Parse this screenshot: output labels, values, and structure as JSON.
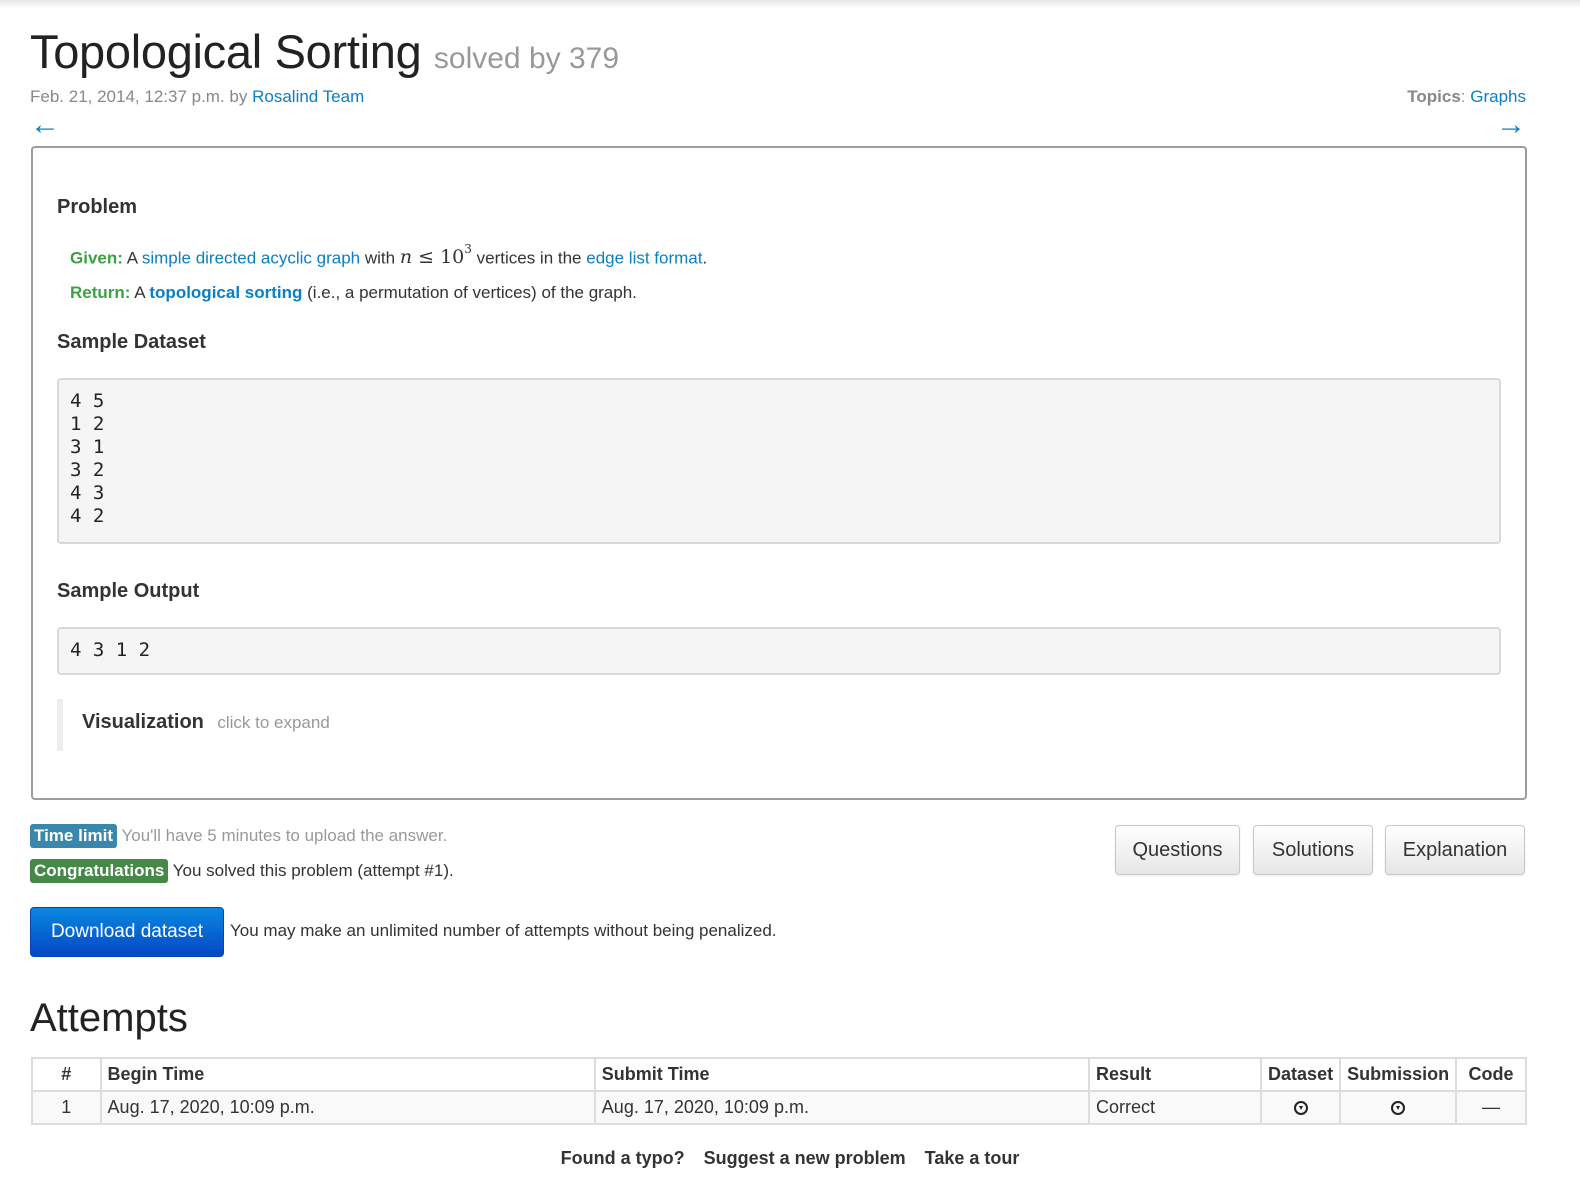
{
  "header": {
    "title": "Topological Sorting",
    "solved_by": "solved by 379",
    "date": "Feb. 21, 2014, 12:37 p.m. by",
    "author": "Rosalind Team",
    "topics_label": "Topics",
    "topics_sep": ":",
    "topic": "Graphs",
    "prev_arrow": "←",
    "next_arrow": "→"
  },
  "problem": {
    "heading": "Problem",
    "given_label": "Given:",
    "given_a": "A",
    "given_link1": "simple directed acyclic graph",
    "given_with": "with",
    "math_n": "n",
    "math_le": "≤ 10",
    "math_exp": "3",
    "given_mid": "vertices in the",
    "given_link2": "edge list format",
    "given_end": ".",
    "return_label": "Return:",
    "return_a": "A",
    "return_link": "topological sorting",
    "return_rest": "(i.e., a permutation of vertices) of the graph.",
    "sample_dataset_heading": "Sample Dataset",
    "sample_dataset": "4 5\n1 2\n3 1\n3 2\n4 3\n4 2",
    "sample_output_heading": "Sample Output",
    "sample_output": "4 3 1 2",
    "visualization_title": "Visualization",
    "visualization_hint": "click to expand"
  },
  "status": {
    "time_limit_badge": "Time limit",
    "time_limit_text": "You'll have 5 minutes to upload the answer.",
    "congrats_badge": "Congratulations",
    "congrats_text": "You solved this problem (attempt #1).",
    "info_color": "#3a87ad",
    "success_color": "#468847"
  },
  "buttons": {
    "questions": "Questions",
    "solutions": "Solutions",
    "explanation": "Explanation",
    "download": "Download dataset",
    "download_note": "You may make an unlimited number of attempts without being penalized."
  },
  "attempts": {
    "heading": "Attempts",
    "columns": [
      "#",
      "Begin Time",
      "Submit Time",
      "Result",
      "Dataset",
      "Submission",
      "Code"
    ],
    "rows": [
      {
        "num": "1",
        "begin": "Aug. 17, 2020, 10:09 p.m.",
        "submit": "Aug. 17, 2020, 10:09 p.m.",
        "result": "Correct",
        "dataset_icon": "download-circle-icon",
        "submission_icon": "download-circle-icon",
        "code": "—"
      }
    ]
  },
  "footer": {
    "typo": "Found a typo?",
    "suggest": "Suggest a new problem",
    "tour": "Take a tour"
  },
  "colors": {
    "link": "#0a7fc4",
    "green_label": "#3aa343",
    "primary_button": "#0a6fd6"
  }
}
